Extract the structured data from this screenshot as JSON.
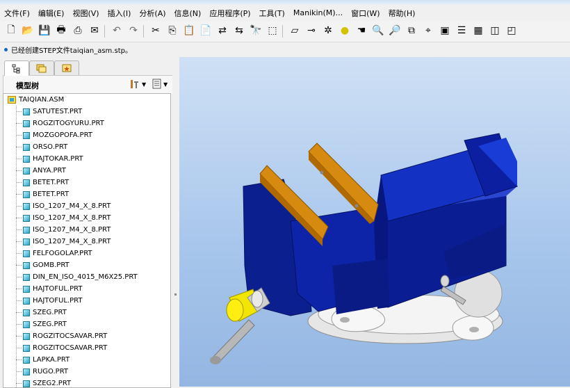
{
  "menu": [
    "文件(F)",
    "编辑(E)",
    "视图(V)",
    "插入(I)",
    "分析(A)",
    "信息(N)",
    "应用程序(P)",
    "工具(T)",
    "Manikin(M)...",
    "窗口(W)",
    "帮助(H)"
  ],
  "toolbar_icons": [
    "new-file-icon",
    "open-folder-icon",
    "save-icon",
    "print-icon",
    "print-preview-icon",
    "send-icon",
    "undo-icon",
    "redo-icon",
    "cut-icon",
    "copy-icon",
    "paste-icon",
    "paste-special-icon",
    "regenerate-icon",
    "regenerate-manager-icon",
    "find-icon",
    "select-box-icon",
    "datum-display-icon",
    "axis-display-icon",
    "point-display-icon",
    "csys-display-icon",
    "spin-center-icon",
    "zoom-in-icon",
    "zoom-out-icon",
    "refit-icon",
    "orient-icon",
    "view-manager-icon",
    "layers-icon",
    "appearance-icon",
    "wireframe-icon",
    "hidden-line-icon"
  ],
  "message": "已经创建STEP文件taiqian_asm.stp。",
  "panel": {
    "title": "模型树",
    "tabs": [
      "model-tree-tab-icon",
      "folder-browser-tab-icon",
      "favorites-tab-icon"
    ]
  },
  "tree": {
    "root": "TAIQIAN.ASM",
    "items": [
      "SATUTEST.PRT",
      "ROGZITOGYURU.PRT",
      "MOZGOPOFA.PRT",
      "ORSO.PRT",
      "HAJTOKAR.PRT",
      "ANYA.PRT",
      "BETET.PRT",
      "BETET.PRT",
      "ISO_1207_M4_X_8.PRT",
      "ISO_1207_M4_X_8.PRT",
      "ISO_1207_M4_X_8.PRT",
      "ISO_1207_M4_X_8.PRT",
      "FELFOGOLAP.PRT",
      "GOMB.PRT",
      "DIN_EN_ISO_4015_M6X25.PRT",
      "HAJTOFUL.PRT",
      "HAJTOFUL.PRT",
      "SZEG.PRT",
      "SZEG.PRT",
      "ROGZITOCSAVAR.PRT",
      "ROGZITOCSAVAR.PRT",
      "LAPKA.PRT",
      "RUGO.PRT",
      "SZEG2.PRT"
    ]
  },
  "viewport": {
    "model": "bench-vise-3d-model"
  }
}
